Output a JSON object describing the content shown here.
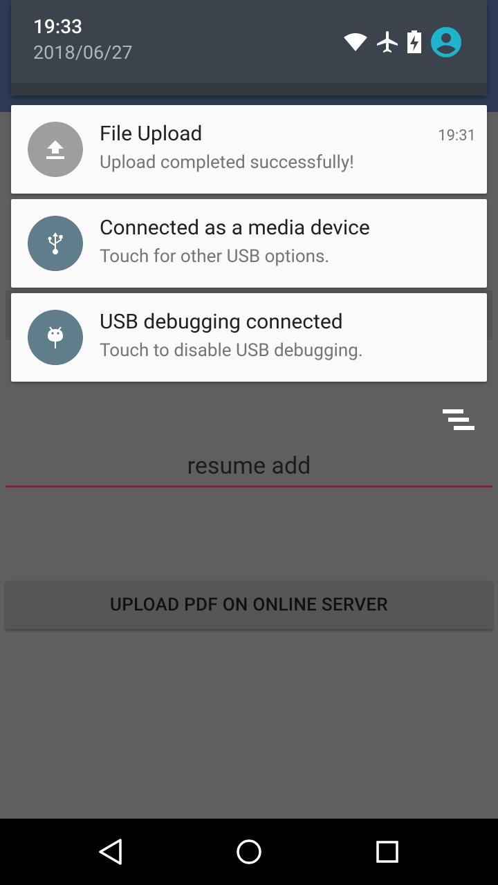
{
  "status_bar": {
    "time": "19:33",
    "date": "2018/06/27"
  },
  "notifications": [
    {
      "title": "File Upload",
      "text": "Upload completed successfully!",
      "time": "19:31",
      "icon": "upload-icon",
      "icon_bg": "#9e9e9e"
    },
    {
      "title": "Connected as a media device",
      "text": "Touch for other USB options.",
      "icon": "usb-icon",
      "icon_bg": "#607d8b"
    },
    {
      "title": "USB debugging connected",
      "text": "Touch to disable USB debugging.",
      "icon": "android-bug-icon",
      "icon_bg": "#607d8b"
    }
  ],
  "app": {
    "input_value": "resume add",
    "upload_button_label": "UPLOAD PDF ON ONLINE SERVER",
    "accent_color": "#8b1c47"
  },
  "nav": {
    "back": "back-icon",
    "home": "home-icon",
    "recents": "recents-icon"
  }
}
